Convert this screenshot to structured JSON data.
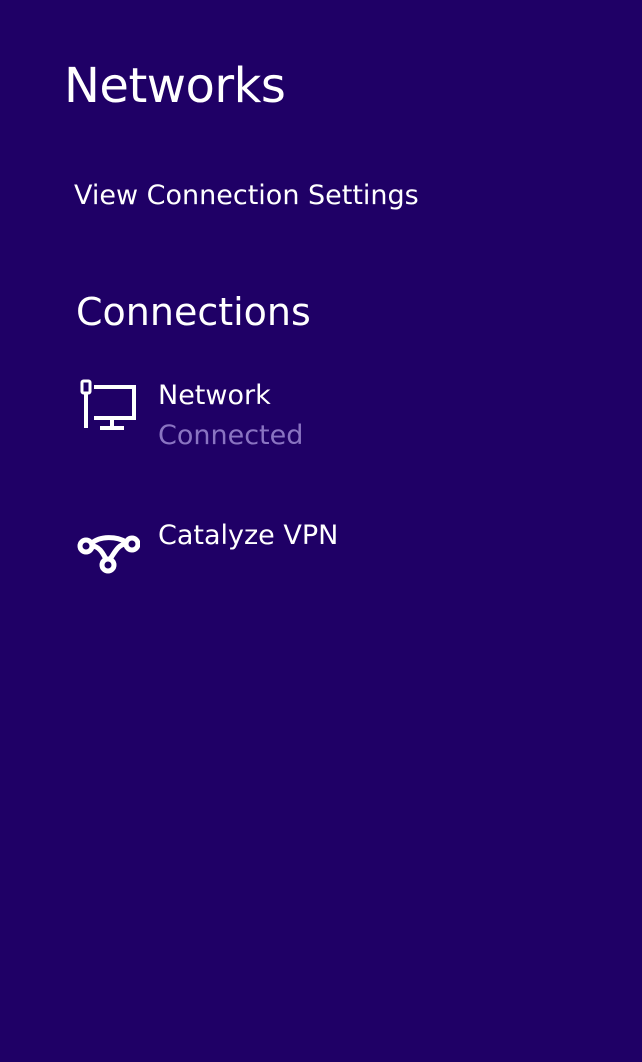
{
  "pane": {
    "title": "Networks",
    "settings_link": "View Connection Settings"
  },
  "connections": {
    "heading": "Connections",
    "items": [
      {
        "name": "Network",
        "status": "Connected",
        "icon": "wired-network-icon"
      },
      {
        "name": "Catalyze VPN",
        "status": "",
        "icon": "vpn-icon"
      }
    ]
  },
  "colors": {
    "background": "#1f0066",
    "text": "#ffffff",
    "status_text": "#8a74c2"
  }
}
